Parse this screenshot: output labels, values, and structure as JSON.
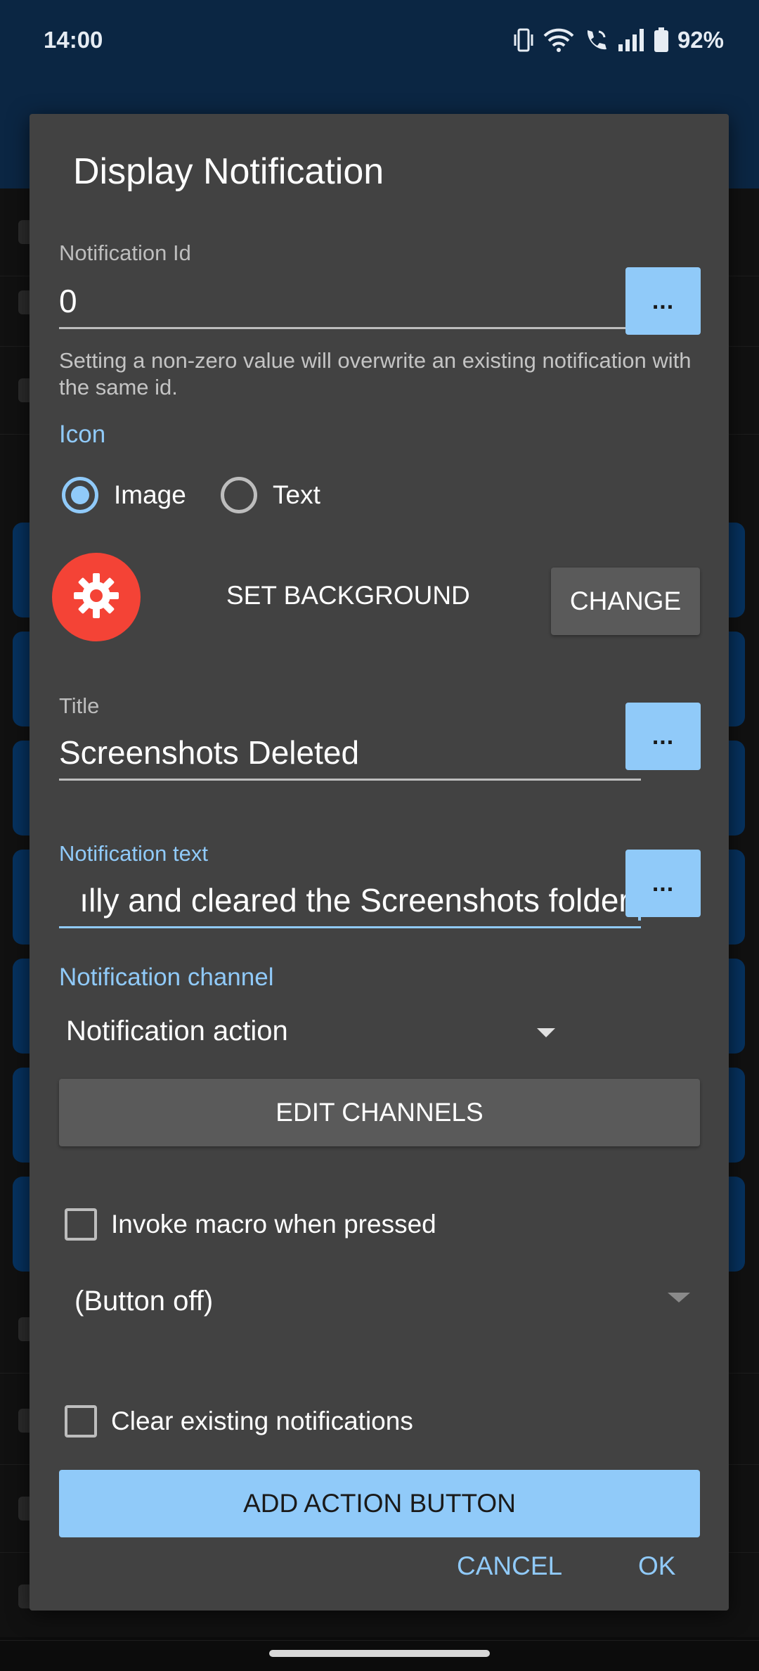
{
  "status_bar": {
    "time": "14:00",
    "battery_percent": "92%",
    "icons": [
      "vibrate-icon",
      "wifi-icon",
      "wifi-call-icon",
      "signal-icon",
      "battery-icon"
    ]
  },
  "dialog": {
    "title": "Display Notification",
    "notification_id": {
      "label": "Notification Id",
      "value": "0",
      "dots_label": "...",
      "helper": "Setting a non-zero value will overwrite an existing notification with the same id."
    },
    "icon_section": {
      "label": "Icon",
      "options": [
        {
          "label": "Image",
          "selected": true
        },
        {
          "label": "Text",
          "selected": false
        }
      ],
      "icon_name": "gear-icon",
      "icon_color": "#f44336",
      "set_background_label": "SET BACKGROUND",
      "change_label": "CHANGE"
    },
    "title_field": {
      "label": "Title",
      "value": "Screenshots Deleted",
      "dots_label": "..."
    },
    "notification_text": {
      "label": "Notification text",
      "value": "ılly and cleared the Screenshots folder.",
      "dots_label": "..."
    },
    "channel": {
      "label": "Notification channel",
      "selected": "Notification action",
      "edit_label": "EDIT CHANNELS"
    },
    "invoke_macro": {
      "label": "Invoke macro when pressed",
      "checked": false
    },
    "button_spinner": {
      "selected": "(Button off)"
    },
    "clear_existing": {
      "label": "Clear existing notifications",
      "checked": false
    },
    "add_action_label": "ADD ACTION BUTTON",
    "actions": {
      "cancel": "CANCEL",
      "ok": "OK"
    }
  },
  "colors": {
    "accent": "#90caf9",
    "dialog_bg": "#424242",
    "header_bg": "#0b2643"
  }
}
